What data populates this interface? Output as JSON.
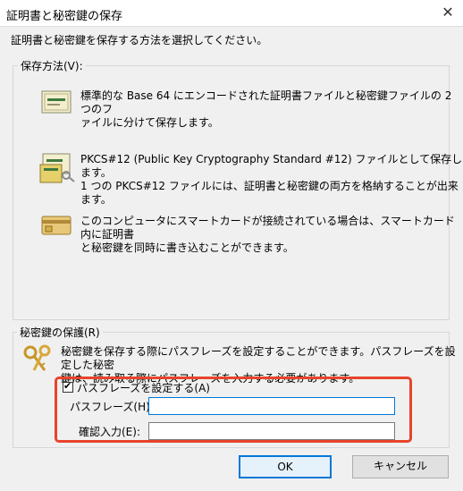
{
  "window": {
    "title": "証明書と秘密鍵の保存",
    "close_symbol": "✕"
  },
  "instruction": "証明書と秘密鍵を保存する方法を選択してください。",
  "save_method": {
    "legend": "保存方法(V):",
    "options": [
      {
        "icon": "certificate-icon",
        "line1": "標準的な Base 64 にエンコードされた証明書ファイルと秘密鍵ファイルの 2 つのフ",
        "line2": "ァイルに分けて保存します。"
      },
      {
        "icon": "pkcs12-key-icon",
        "line1": "PKCS#12 (Public Key Cryptography Standard #12) ファイルとして保存します。",
        "line2": "1 つの PKCS#12 ファイルには、証明書と秘密鍵の両方を格納することが出来ます。"
      },
      {
        "icon": "smart-card-icon",
        "line1": "このコンピュータにスマートカードが接続されている場合は、スマートカード内に証明書",
        "line2": "と秘密鍵を同時に書き込むことができます。"
      }
    ]
  },
  "protection": {
    "legend": "秘密鍵の保護(R)",
    "icon": "keys-icon",
    "line1": "秘密鍵を保存する際にパスフレーズを設定することができます。パスフレーズを設定した秘密",
    "line2": "鍵は、読み取る際にパスフレーズを入力する必要があります。",
    "checkbox_label": "パスフレーズを設定する(A)",
    "checkbox_checked": true,
    "check_mark": "✔",
    "passphrase_label": "パスフレーズ(H):",
    "passphrase_value": "",
    "confirm_label": "確認入力(E):",
    "confirm_value": ""
  },
  "buttons": {
    "ok": "OK",
    "cancel": "キャンセル"
  },
  "colors": {
    "highlight_border": "#e8432c",
    "focus_border": "#0078d7"
  }
}
